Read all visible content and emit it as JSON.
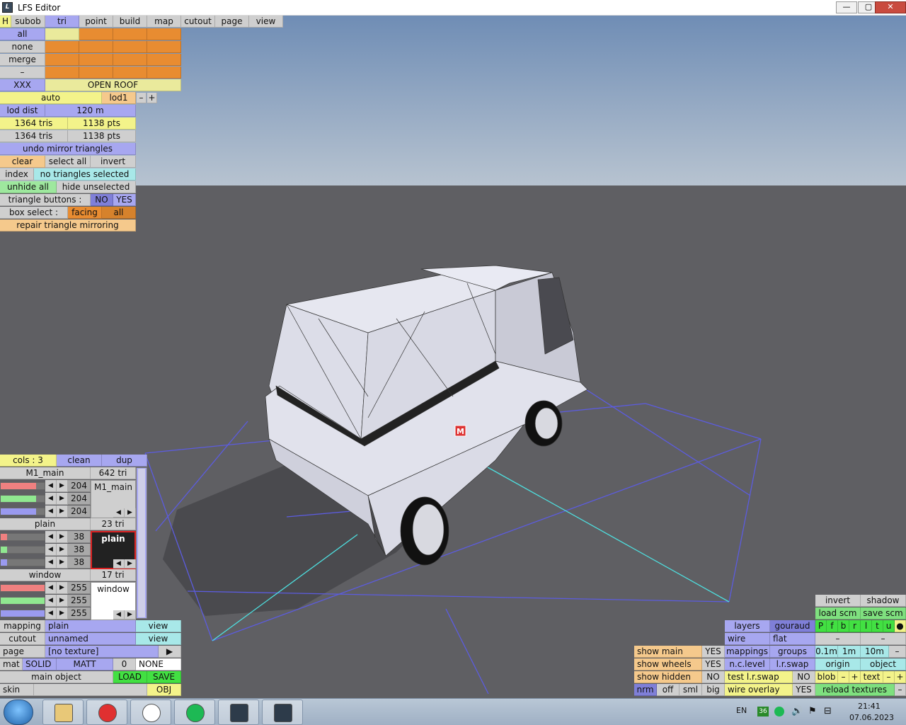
{
  "window": {
    "title": "LFS Editor",
    "min": "—",
    "max": "▢",
    "close": "✕"
  },
  "tabs": [
    "H",
    "subob",
    "tri",
    "point",
    "build",
    "map",
    "cutout",
    "page",
    "view"
  ],
  "subob": {
    "all": "all",
    "none": "none",
    "merge": "merge",
    "dash": "–"
  },
  "obj_name": {
    "label": "XXX",
    "value": "OPEN ROOF"
  },
  "lod": {
    "auto": "auto",
    "lod1": "lod1",
    "minus": "–",
    "plus": "+",
    "dist_label": "lod dist",
    "dist_value": "120 m"
  },
  "counts": {
    "tris1": "1364 tris",
    "pts1": "1138 pts",
    "tris2": "1364 tris",
    "pts2": "1138 pts"
  },
  "tri": {
    "undo": "undo mirror triangles",
    "clear": "clear",
    "select_all": "select all",
    "invert": "invert",
    "index": "index",
    "sel_status": "no triangles selected",
    "unhide": "unhide all",
    "hide_unsel": "hide unselected",
    "tb_label": "triangle buttons :",
    "no": "NO",
    "yes": "YES",
    "box_label": "box select :",
    "facing": "facing",
    "all": "all",
    "repair": "repair triangle mirroring"
  },
  "cols": {
    "label": "cols : 3",
    "clean": "clean",
    "dup": "dup"
  },
  "materials": [
    {
      "name": "M1_main",
      "tris": "642 tri",
      "r": "204",
      "g": "204",
      "b": "204",
      "preview": "M1_main",
      "r_level": 0.8,
      "g_level": 0.8,
      "b_level": 0.8
    },
    {
      "name": "plain",
      "tris": "23 tri",
      "r": "38",
      "g": "38",
      "b": "38",
      "preview": "plain",
      "r_level": 0.15,
      "g_level": 0.15,
      "b_level": 0.15
    },
    {
      "name": "window",
      "tris": "17 tri",
      "r": "255",
      "g": "255",
      "b": "255",
      "preview": "window",
      "r_level": 1,
      "g_level": 1,
      "b_level": 1
    }
  ],
  "bottom_left": {
    "mapping": "mapping",
    "mapping_val": "plain",
    "view": "view",
    "cutout": "cutout",
    "cutout_val": "unnamed",
    "view2": "view",
    "page": "page",
    "page_val": "[no texture]",
    "page_arrow": "▶",
    "mat": "mat",
    "solid": "SOLID",
    "matt": "MATT",
    "zero": "0",
    "none": "NONE",
    "main_object": "main object",
    "load": "LOAD",
    "save": "SAVE",
    "skin": "skin",
    "obj": "OBJ"
  },
  "br": {
    "invert": "invert",
    "shadow": "shadow",
    "load_scm": "load scm",
    "save_scm": "save scm",
    "pfbrltu": [
      "P",
      "f",
      "b",
      "r",
      "l",
      "t",
      "u"
    ],
    "dot": "●",
    "d1": "–",
    "d2": "–",
    "layers": "layers",
    "gouraud": "gouraud",
    "wire": "wire",
    "flat": "flat",
    "show_main": "show main",
    "yes1": "YES",
    "mappings": "mappings",
    "groups": "groups",
    "s01": "0.1m",
    "s1": "1m",
    "s10": "10m",
    "sm": "–",
    "show_wheels": "show wheels",
    "yes2": "YES",
    "nclevel": "n.c.level",
    "lrswap": "l.r.swap",
    "origin": "origin",
    "object": "object",
    "show_hidden": "show hidden",
    "no1": "NO",
    "test": "test l.r.swap",
    "no2": "NO",
    "blob": "blob",
    "bm": "–",
    "bp": "+",
    "text": "text",
    "tm": "–",
    "tp": "+",
    "nrm": "nrm",
    "off": "off",
    "sml": "sml",
    "big": "big",
    "wire_overlay": "wire overlay",
    "yes3": "YES",
    "reload": "reload textures",
    "rm": "–"
  },
  "viewport": {
    "marker": "M"
  },
  "taskbar": {
    "lang": "EN",
    "badge": "36",
    "time": "21:41",
    "date": "07.06.2023",
    "apps": [
      "folder-app",
      "opera-app",
      "chrome-app",
      "spotify-app",
      "lfs-app-1",
      "lfs-app-2"
    ]
  },
  "colors": {
    "sky_top": "#6f8db5",
    "sky_bottom": "#b7c3d0",
    "ground": "#5f5f63",
    "grid": "#5c5ce0",
    "grid_cyan": "#4ee0e0",
    "van": "#e9eaf3"
  }
}
